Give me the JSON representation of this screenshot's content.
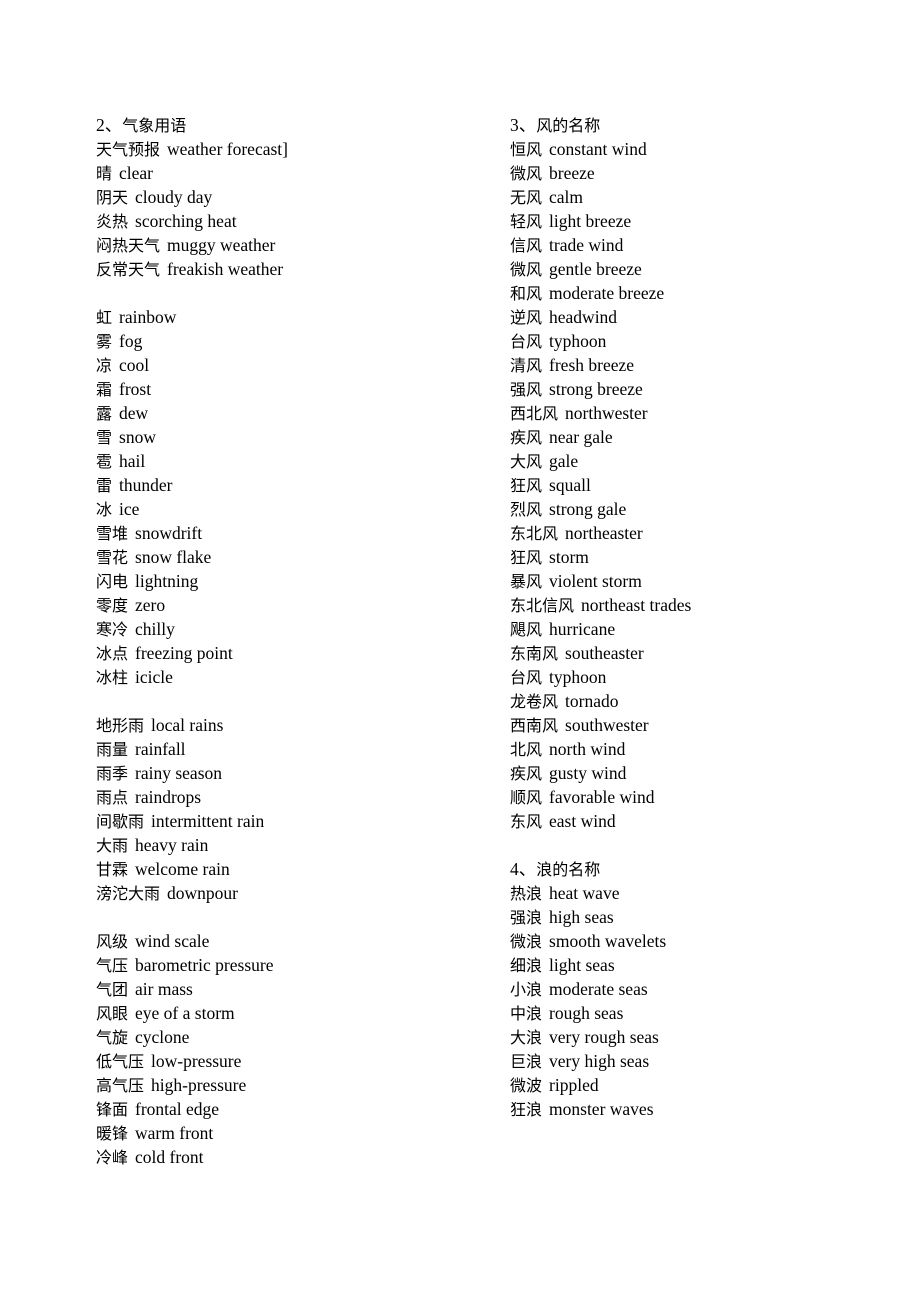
{
  "document": {
    "title": "气象用语 / 风的名称 / 浪的名称",
    "background_color": "#ffffff",
    "text_color": "#000000"
  },
  "columns": {
    "left": {
      "groups": [
        {
          "heading": {
            "number": "2、",
            "term": "气象用语"
          },
          "entries": [
            {
              "term": "天气预报",
              "gloss": "weather forecast]"
            },
            {
              "term": "晴",
              "gloss": "clear"
            },
            {
              "term": "阴天",
              "gloss": "cloudy day"
            },
            {
              "term": "炎热",
              "gloss": "scorching heat"
            },
            {
              "term": "闷热天气",
              "gloss": "muggy weather"
            },
            {
              "term": "反常天气",
              "gloss": "freakish weather"
            }
          ]
        },
        {
          "heading": null,
          "entries": [
            {
              "term": "虹",
              "gloss": "rainbow"
            },
            {
              "term": "雾",
              "gloss": "fog"
            },
            {
              "term": "凉",
              "gloss": "cool"
            },
            {
              "term": "霜",
              "gloss": "frost"
            },
            {
              "term": "露",
              "gloss": "dew"
            },
            {
              "term": "雪",
              "gloss": "snow"
            },
            {
              "term": "雹",
              "gloss": "hail"
            },
            {
              "term": "雷",
              "gloss": "thunder"
            },
            {
              "term": "冰",
              "gloss": "ice"
            },
            {
              "term": "雪堆",
              "gloss": "snowdrift"
            },
            {
              "term": "雪花",
              "gloss": "snow flake"
            },
            {
              "term": "闪电",
              "gloss": "lightning"
            },
            {
              "term": "零度",
              "gloss": "zero"
            },
            {
              "term": "寒冷",
              "gloss": "chilly"
            },
            {
              "term": "冰点",
              "gloss": "freezing point"
            },
            {
              "term": "冰柱",
              "gloss": "icicle"
            }
          ]
        },
        {
          "heading": null,
          "entries": [
            {
              "term": "地形雨",
              "gloss": "local rains"
            },
            {
              "term": "雨量",
              "gloss": "rainfall"
            },
            {
              "term": "雨季",
              "gloss": "rainy season"
            },
            {
              "term": "雨点",
              "gloss": "raindrops"
            },
            {
              "term": "间歇雨",
              "gloss": "intermittent rain"
            },
            {
              "term": "大雨",
              "gloss": "heavy rain"
            },
            {
              "term": "甘霖",
              "gloss": "welcome rain"
            },
            {
              "term": "滂沱大雨",
              "gloss": "downpour"
            }
          ]
        },
        {
          "heading": null,
          "entries": [
            {
              "term": "风级",
              "gloss": "wind scale"
            },
            {
              "term": "气压",
              "gloss": "barometric pressure"
            },
            {
              "term": "气团",
              "gloss": "air mass"
            },
            {
              "term": "风眼",
              "gloss": "eye of a storm"
            },
            {
              "term": "气旋",
              "gloss": "cyclone"
            },
            {
              "term": "低气压",
              "gloss": "low-pressure"
            },
            {
              "term": "高气压",
              "gloss": "high-pressure"
            },
            {
              "term": "锋面",
              "gloss": "frontal edge"
            },
            {
              "term": "暖锋",
              "gloss": "warm front"
            },
            {
              "term": "冷峰",
              "gloss": "cold front"
            }
          ]
        }
      ]
    },
    "right": {
      "groups": [
        {
          "heading": {
            "number": "3、",
            "term": "风的名称"
          },
          "entries": [
            {
              "term": "恒风",
              "gloss": "constant wind"
            },
            {
              "term": "微风",
              "gloss": "breeze"
            },
            {
              "term": "无风",
              "gloss": "calm"
            },
            {
              "term": "轻风",
              "gloss": "light breeze"
            },
            {
              "term": "信风",
              "gloss": "trade wind"
            },
            {
              "term": "微风",
              "gloss": "gentle breeze"
            },
            {
              "term": "和风",
              "gloss": "moderate breeze"
            },
            {
              "term": "逆风",
              "gloss": "headwind"
            },
            {
              "term": "台风",
              "gloss": "typhoon"
            },
            {
              "term": "清风",
              "gloss": "fresh breeze"
            },
            {
              "term": "强风",
              "gloss": "strong breeze"
            },
            {
              "term": "西北风",
              "gloss": "northwester"
            },
            {
              "term": "疾风",
              "gloss": "near gale"
            },
            {
              "term": "大风",
              "gloss": "gale"
            },
            {
              "term": "狂风",
              "gloss": "squall"
            },
            {
              "term": "烈风",
              "gloss": "strong gale"
            },
            {
              "term": "东北风",
              "gloss": "northeaster"
            },
            {
              "term": "狂风",
              "gloss": "storm"
            },
            {
              "term": "暴风",
              "gloss": "violent storm"
            },
            {
              "term": "东北信风",
              "gloss": "northeast trades"
            },
            {
              "term": "飓风",
              "gloss": "hurricane"
            },
            {
              "term": "东南风",
              "gloss": "southeaster"
            },
            {
              "term": "台风",
              "gloss": "typhoon"
            },
            {
              "term": "龙卷风",
              "gloss": "tornado"
            },
            {
              "term": "西南风",
              "gloss": "southwester"
            },
            {
              "term": "北风",
              "gloss": "north wind"
            },
            {
              "term": "疾风",
              "gloss": "gusty wind"
            },
            {
              "term": "顺风",
              "gloss": "favorable wind"
            },
            {
              "term": "东风",
              "gloss": "east wind"
            }
          ]
        },
        {
          "heading": {
            "number": "4、",
            "term": "浪的名称"
          },
          "entries": [
            {
              "term": "热浪",
              "gloss": "heat wave"
            },
            {
              "term": "强浪",
              "gloss": "high seas"
            },
            {
              "term": "微浪",
              "gloss": "smooth wavelets"
            },
            {
              "term": "细浪",
              "gloss": "light seas"
            },
            {
              "term": "小浪",
              "gloss": "moderate seas"
            },
            {
              "term": "中浪",
              "gloss": "rough seas"
            },
            {
              "term": "大浪",
              "gloss": "very rough seas"
            },
            {
              "term": "巨浪",
              "gloss": "very high seas"
            },
            {
              "term": "微波",
              "gloss": "rippled"
            },
            {
              "term": "狂浪",
              "gloss": "monster waves"
            }
          ]
        }
      ]
    }
  }
}
